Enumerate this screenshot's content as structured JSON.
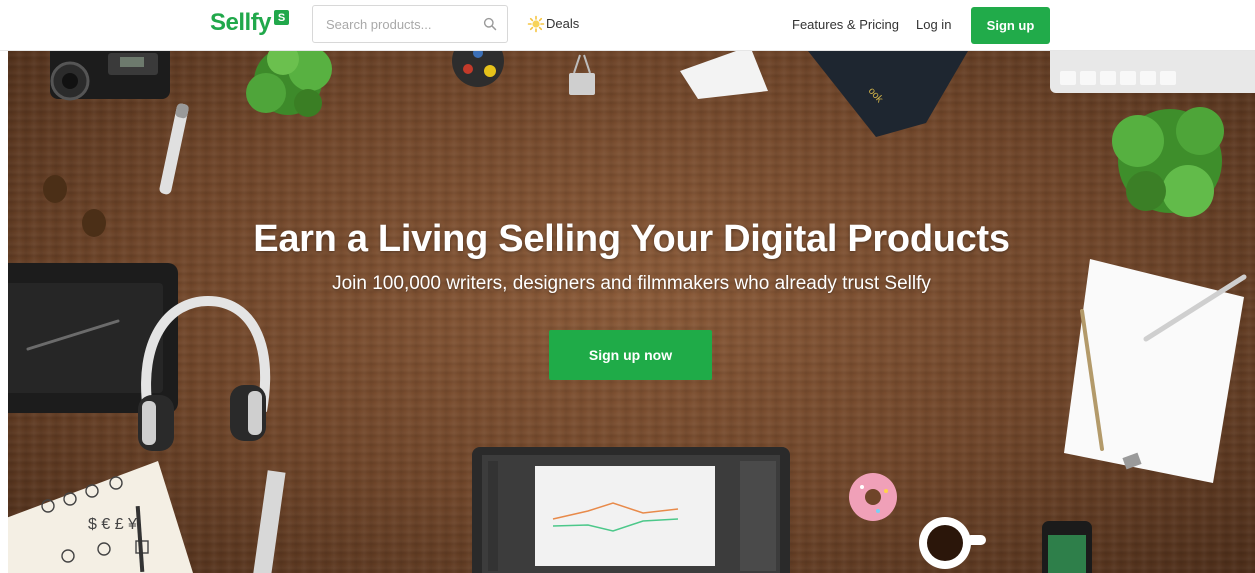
{
  "header": {
    "logo_text": "Sellfy",
    "logo_badge": "S",
    "search": {
      "placeholder": "Search products...",
      "value": ""
    },
    "deals_label": "Deals",
    "nav": {
      "features_label": "Features & Pricing",
      "login_label": "Log in",
      "signup_label": "Sign up"
    }
  },
  "hero": {
    "title": "Earn a Living Selling Your Digital Products",
    "subtitle": "Join 100,000 writers, designers and filmmakers who already trust Sellfy",
    "cta_label": "Sign up now",
    "notebook_text": "ook"
  },
  "colors": {
    "brand_green": "#21ab4a",
    "hero_wood": "#7a4d2f",
    "text_dark": "#333333"
  },
  "icons": [
    "search-icon",
    "deals-sun-icon"
  ]
}
